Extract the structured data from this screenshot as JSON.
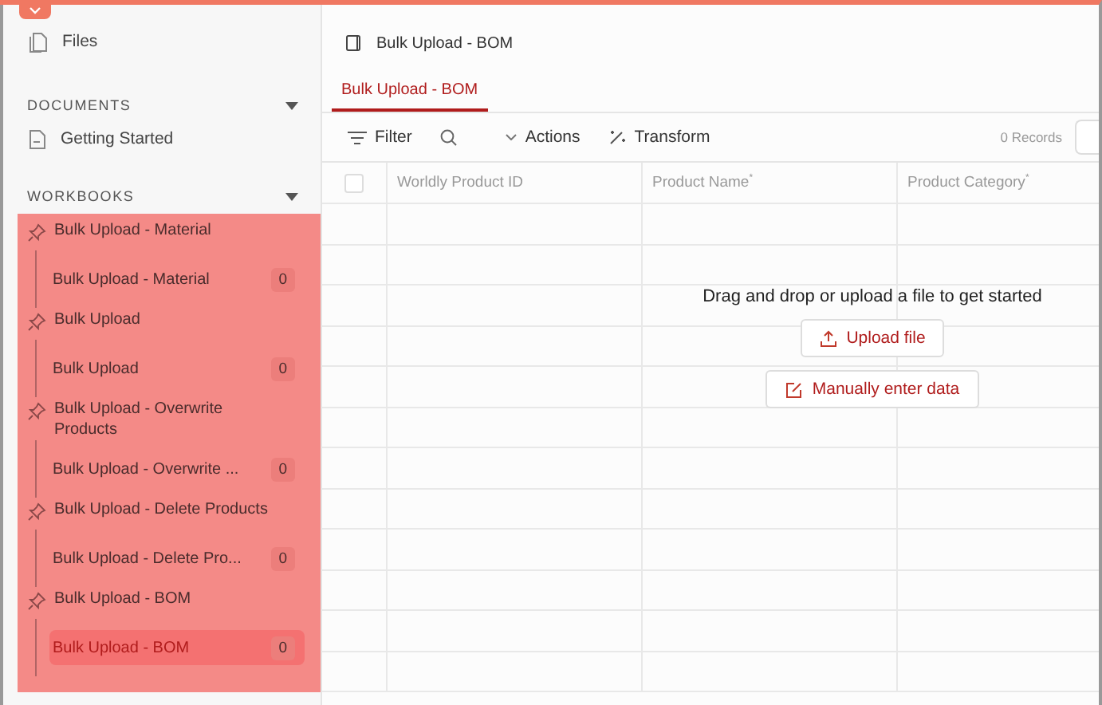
{
  "sidebar": {
    "files_label": "Files",
    "sections": [
      {
        "title": "DOCUMENTS",
        "expanded": true,
        "items": [
          {
            "label": "Getting Started"
          }
        ]
      },
      {
        "title": "WORKBOOKS",
        "expanded": true,
        "highlighted": true,
        "workbooks": [
          {
            "name": "Bulk Upload - Material",
            "sheets": [
              {
                "label": "Bulk Upload - Material",
                "count": "0",
                "selected": false
              }
            ]
          },
          {
            "name": "Bulk Upload",
            "sheets": [
              {
                "label": "Bulk Upload",
                "count": "0",
                "selected": false
              }
            ]
          },
          {
            "name": "Bulk Upload - Overwrite Products",
            "sheets": [
              {
                "label": "Bulk Upload - Overwrite ...",
                "count": "0",
                "selected": false
              }
            ]
          },
          {
            "name": "Bulk Upload - Delete Products",
            "sheets": [
              {
                "label": "Bulk Upload - Delete Pro...",
                "count": "0",
                "selected": false
              }
            ]
          },
          {
            "name": "Bulk Upload - BOM",
            "sheets": [
              {
                "label": "Bulk Upload - BOM",
                "count": "0",
                "selected": true
              }
            ]
          }
        ]
      }
    ]
  },
  "header": {
    "title": "Bulk Upload - BOM"
  },
  "tabs": [
    {
      "label": "Bulk Upload - BOM",
      "selected": true
    }
  ],
  "toolbar": {
    "filter": "Filter",
    "actions": "Actions",
    "transform": "Transform",
    "records": "0 Records"
  },
  "table": {
    "select_all": {
      "checked": false
    },
    "columns": [
      {
        "label": "Worldly Product ID"
      },
      {
        "label": "Product Name",
        "required_mark": "*"
      },
      {
        "label": "Product Category",
        "required_mark": "*"
      }
    ]
  },
  "empty_state": {
    "message": "Drag and drop or upload a file to get started",
    "upload": "Upload file",
    "manual": "Manually enter data"
  }
}
